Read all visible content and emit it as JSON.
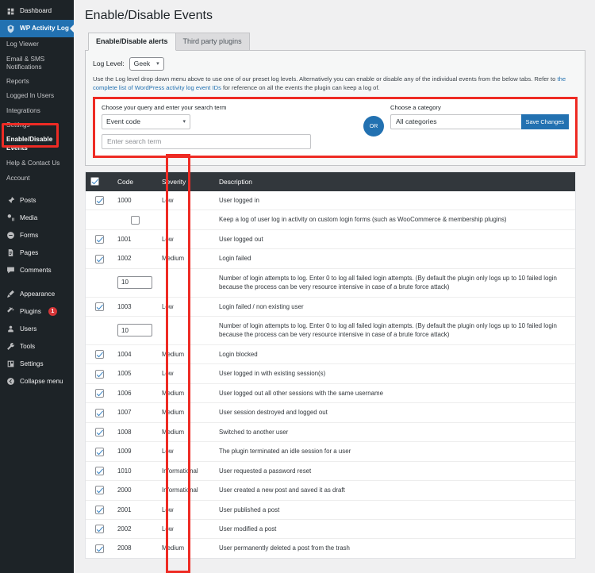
{
  "sidebar": {
    "top_items": [
      {
        "label": "Dashboard",
        "icon": "dashboard-icon",
        "active": false
      }
    ],
    "plugin_item": {
      "label": "WP Activity Log",
      "icon": "shield-icon",
      "active": true
    },
    "plugin_submenu": [
      {
        "label": "Log Viewer",
        "highlighted": false
      },
      {
        "label": "Email & SMS Notifications",
        "highlighted": false
      },
      {
        "label": "Reports",
        "highlighted": false
      },
      {
        "label": "Logged In Users",
        "highlighted": false
      },
      {
        "label": "Integrations",
        "highlighted": false
      },
      {
        "label": "Settings",
        "highlighted": false
      },
      {
        "label": "Enable/Disable Events",
        "highlighted": true
      },
      {
        "label": "Help & Contact Us",
        "highlighted": false
      },
      {
        "label": "Account",
        "highlighted": false
      }
    ],
    "menu_items": [
      {
        "label": "Posts",
        "icon": "pin-icon",
        "badge": ""
      },
      {
        "label": "Media",
        "icon": "media-icon",
        "badge": ""
      },
      {
        "label": "Forms",
        "icon": "forms-icon",
        "badge": ""
      },
      {
        "label": "Pages",
        "icon": "pages-icon",
        "badge": ""
      },
      {
        "label": "Comments",
        "icon": "comment-icon",
        "badge": ""
      }
    ],
    "menu_items_2": [
      {
        "label": "Appearance",
        "icon": "brush-icon",
        "badge": ""
      },
      {
        "label": "Plugins",
        "icon": "plug-icon",
        "badge": "1"
      },
      {
        "label": "Users",
        "icon": "user-icon",
        "badge": ""
      },
      {
        "label": "Tools",
        "icon": "wrench-icon",
        "badge": ""
      },
      {
        "label": "Settings",
        "icon": "settings-icon",
        "badge": ""
      }
    ],
    "collapse": {
      "label": "Collapse menu",
      "icon": "collapse-icon"
    }
  },
  "header": {
    "page_title": "Enable/Disable Events"
  },
  "tabs": [
    {
      "label": "Enable/Disable alerts",
      "active": true
    },
    {
      "label": "Third party plugins",
      "active": false
    }
  ],
  "log_level": {
    "label": "Log Level:",
    "value": "Geek",
    "caret": "chevron-down-icon"
  },
  "help": {
    "line1": "Use the Log level drop down menu above to use one of our preset log levels. Alternatively you can enable or disable any of the individual events from the below tabs. Refer to",
    "link": "the complete list of WordPress activity log event IDs",
    "line2": "for reference on all the events the plugin can keep a log of."
  },
  "query": {
    "left_label": "Choose your query and enter your search term",
    "select_value": "Event code",
    "search_placeholder": "Enter search term",
    "search_value": "",
    "or_label": "OR",
    "category_label": "Choose a category",
    "category_value": "All categories",
    "save_label": "Save Changes"
  },
  "table": {
    "columns": [
      "",
      "Code",
      "Severity",
      "Description"
    ],
    "header_checkbox_checked": true,
    "rows": [
      {
        "type": "event",
        "checked": true,
        "code": "1000",
        "severity": "Low",
        "description": "User logged in"
      },
      {
        "type": "sub-checkbox",
        "checked": false,
        "code": "",
        "severity": "",
        "description": "Keep a log of user log in activity on custom login forms (such as WooCommerce & membership plugins)"
      },
      {
        "type": "event",
        "checked": true,
        "code": "1001",
        "severity": "Low",
        "description": "User logged out"
      },
      {
        "type": "event",
        "checked": true,
        "code": "1002",
        "severity": "Medium",
        "description": "Login failed"
      },
      {
        "type": "sub-input",
        "input_value": "10",
        "description": "Number of login attempts to log. Enter 0 to log all failed login attempts. (By default the plugin only logs up to 10 failed login because the process can be very resource intensive in case of a brute force attack)"
      },
      {
        "type": "event",
        "checked": true,
        "code": "1003",
        "severity": "Low",
        "description": "Login failed / non existing user"
      },
      {
        "type": "sub-input",
        "input_value": "10",
        "description": "Number of login attempts to log. Enter 0 to log all failed login attempts. (By default the plugin only logs up to 10 failed login because the process can be very resource intensive in case of a brute force attack)"
      },
      {
        "type": "event",
        "checked": true,
        "code": "1004",
        "severity": "Medium",
        "description": "Login blocked"
      },
      {
        "type": "event",
        "checked": true,
        "code": "1005",
        "severity": "Low",
        "description": "User logged in with existing session(s)"
      },
      {
        "type": "event",
        "checked": true,
        "code": "1006",
        "severity": "Medium",
        "description": "User logged out all other sessions with the same username"
      },
      {
        "type": "event",
        "checked": true,
        "code": "1007",
        "severity": "Medium",
        "description": "User session destroyed and logged out"
      },
      {
        "type": "event",
        "checked": true,
        "code": "1008",
        "severity": "Medium",
        "description": "Switched to another user"
      },
      {
        "type": "event",
        "checked": true,
        "code": "1009",
        "severity": "Low",
        "description": "The plugin terminated an idle session for a user"
      },
      {
        "type": "event",
        "checked": true,
        "code": "1010",
        "severity": "Informational",
        "description": "User requested a password reset"
      },
      {
        "type": "event",
        "checked": true,
        "code": "2000",
        "severity": "Informational",
        "description": "User created a new post and saved it as draft"
      },
      {
        "type": "event",
        "checked": true,
        "code": "2001",
        "severity": "Low",
        "description": "User published a post"
      },
      {
        "type": "event",
        "checked": true,
        "code": "2002",
        "severity": "Low",
        "description": "User modified a post"
      },
      {
        "type": "event",
        "checked": true,
        "code": "2008",
        "severity": "Medium",
        "description": "User permanently deleted a post from the trash"
      }
    ]
  },
  "colors": {
    "highlight": "#ee2b24",
    "accent_blue": "#2271b1",
    "sidebar_bg": "#1d2327",
    "table_header_bg": "#32373c",
    "badge_red": "#d63638"
  }
}
